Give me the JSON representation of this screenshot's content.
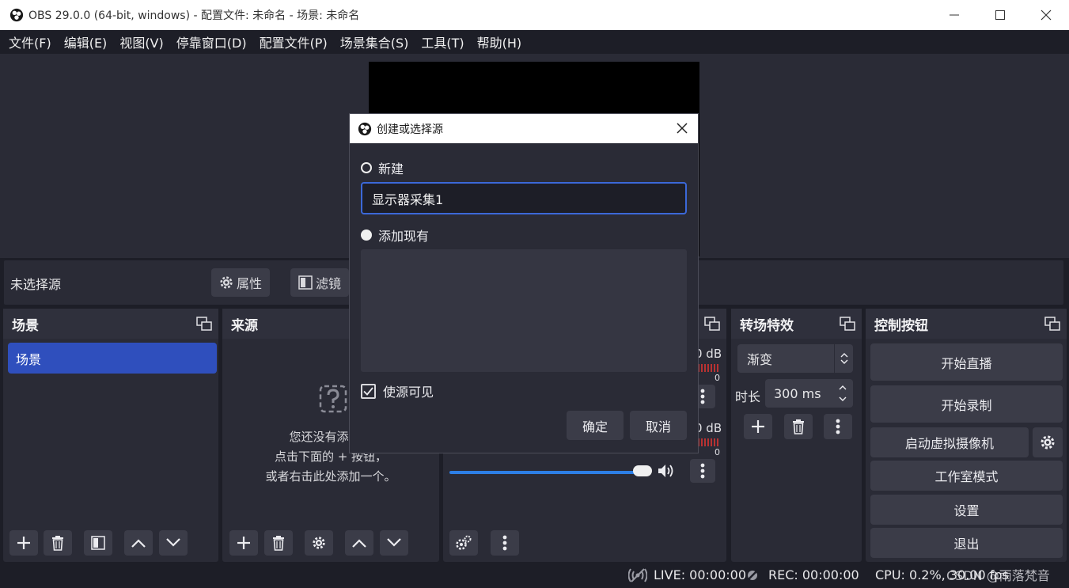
{
  "window": {
    "title": "OBS 29.0.0 (64-bit, windows) - 配置文件: 未命名 - 场景: 未命名"
  },
  "menu": [
    "文件(F)",
    "编辑(E)",
    "视图(V)",
    "停靠窗口(D)",
    "配置文件(P)",
    "场景集合(S)",
    "工具(T)",
    "帮助(H)"
  ],
  "source_toolbar": {
    "no_selection": "未选择源",
    "properties": "属性",
    "filters": "滤镜"
  },
  "scenes": {
    "title": "场景",
    "items": [
      "场景"
    ]
  },
  "sources": {
    "title": "来源",
    "empty_line1": "您还没有添加任",
    "empty_line2": "点击下面的 + 按钮，",
    "empty_line3": "或者右击此处添加一个。"
  },
  "mixer": {
    "db1": "0 dB",
    "db2": "0 dB",
    "scale_end1": "0",
    "scale_end2": "0"
  },
  "transitions": {
    "title": "转场特效",
    "type": "渐变",
    "duration_label": "时长",
    "duration": "300 ms"
  },
  "controls": {
    "title": "控制按钮",
    "start_stream": "开始直播",
    "start_record": "开始录制",
    "virtual_cam": "启动虚拟摄像机",
    "studio_mode": "工作室模式",
    "settings": "设置",
    "exit": "退出"
  },
  "status": {
    "live": "LIVE: 00:00:00",
    "rec": "REC: 00:00:00",
    "cpu": "CPU: 0.2%, 30.00 fps",
    "watermark": "CSDN @雨落梵音"
  },
  "dialog": {
    "title": "创建或选择源",
    "create_new": "新建",
    "name_value": "显示器采集1",
    "add_existing": "添加现有",
    "make_visible": "使源可见",
    "ok": "确定",
    "cancel": "取消"
  },
  "colors": {
    "accent": "#2f4fbd",
    "input_focus": "#3b68d8",
    "slider": "#2d7fe6"
  }
}
